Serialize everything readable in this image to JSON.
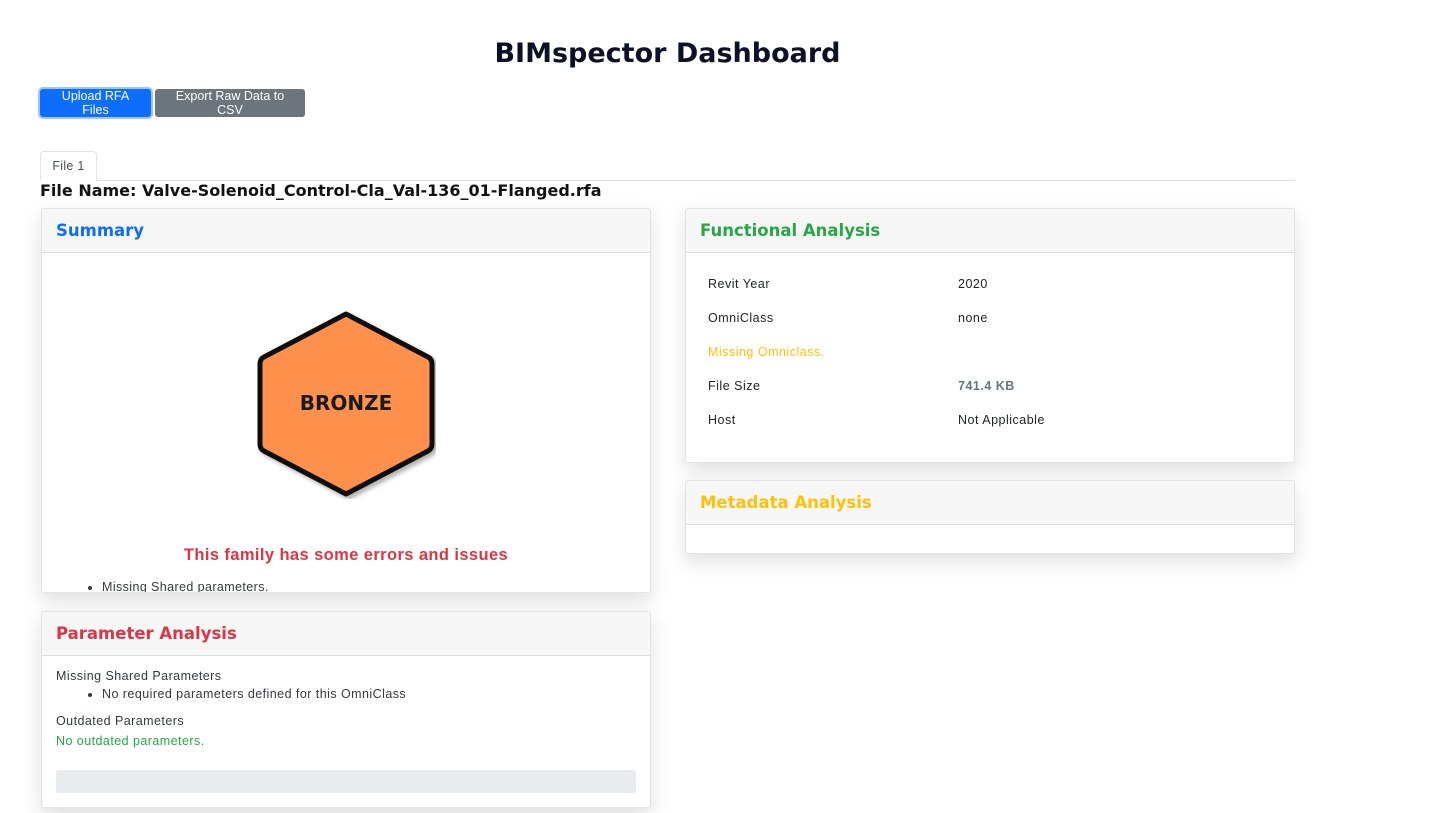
{
  "title": "BIMspector Dashboard",
  "toolbar": {
    "upload_label": "Upload RFA Files",
    "export_label": "Export Raw Data to CSV"
  },
  "tabs": [
    {
      "label": "File 1",
      "active": true
    }
  ],
  "file_name": "File Name: Valve-Solenoid_Control-Cla_Val-136_01-Flanged.rfa",
  "summary": {
    "title": "Summary",
    "badge": "BRONZE",
    "badge_color": "#ff914d",
    "message": "This family has some errors and issues",
    "issues": [
      "Missing Shared parameters."
    ]
  },
  "functional": {
    "title": "Functional Analysis",
    "rows": [
      {
        "label": "Revit Year",
        "value": "2020"
      },
      {
        "label": "OmniClass",
        "value": "none"
      },
      {
        "warning": "Missing Omniclass."
      },
      {
        "label": "File Size",
        "value": "741.4 KB"
      },
      {
        "label": "Host",
        "value": "Not Applicable"
      }
    ]
  },
  "metadata": {
    "title": "Metadata Analysis"
  },
  "parameter": {
    "title": "Parameter Analysis",
    "missing_heading": "Missing Shared Parameters",
    "missing_items": [
      "No required parameters defined for this OmniClass"
    ],
    "outdated_heading": "Outdated Parameters",
    "outdated_status": "No outdated parameters."
  },
  "colors": {
    "summary_title": "#0d6efd",
    "functional_title": "#28a745",
    "metadata_title": "#ffc107",
    "parameter_title": "#dc3545",
    "error_text": "#dc3545"
  }
}
